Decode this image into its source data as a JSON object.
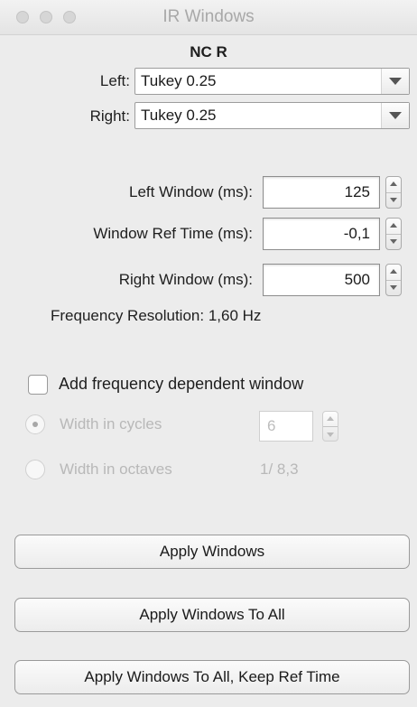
{
  "window": {
    "title": "IR Windows"
  },
  "header": {
    "channel": "NC R"
  },
  "left_window_type": {
    "label": "Left:",
    "value": "Tukey 0.25"
  },
  "right_window_type": {
    "label": "Right:",
    "value": "Tukey 0.25"
  },
  "left_window_ms": {
    "label": "Left Window (ms):",
    "value": "125"
  },
  "window_ref_time_ms": {
    "label": "Window Ref Time (ms):",
    "value": "-0,1"
  },
  "right_window_ms": {
    "label": "Right Window (ms):",
    "value": "500"
  },
  "frequency_resolution": {
    "label": "Frequency Resolution:",
    "value": "1,60 Hz"
  },
  "freq_dependent": {
    "checkbox_label": "Add frequency dependent window",
    "checked": false,
    "width_in_cycles": {
      "label": "Width in cycles",
      "value": "6",
      "selected": true
    },
    "width_in_octaves": {
      "label": "Width in octaves",
      "value": "1/ 8,3",
      "selected": false
    }
  },
  "buttons": {
    "apply": "Apply Windows",
    "apply_all": "Apply Windows To All",
    "apply_all_keep_ref": "Apply Windows To All, Keep Ref Time"
  }
}
